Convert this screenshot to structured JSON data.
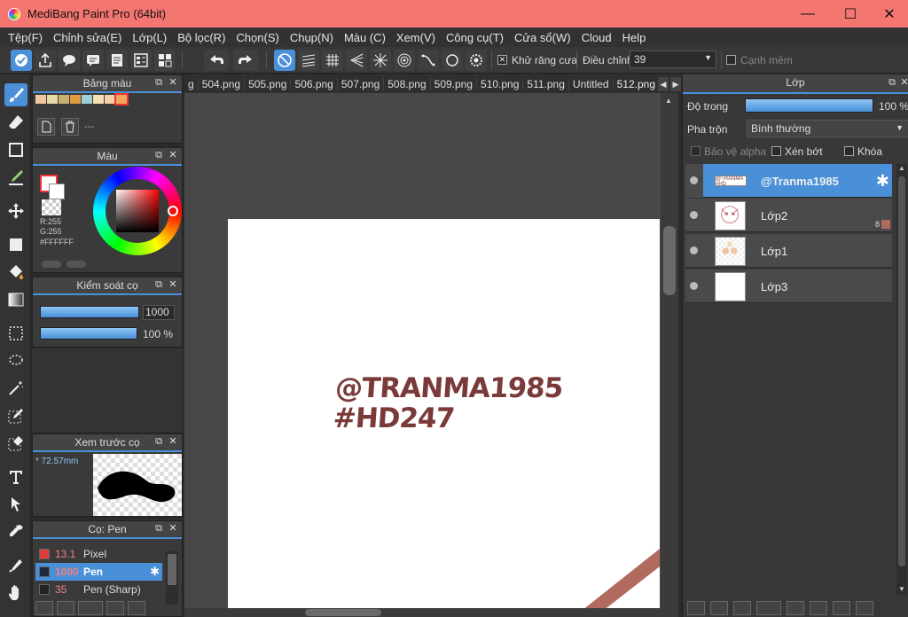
{
  "window": {
    "title": "MediBang Paint Pro (64bit)"
  },
  "menu": [
    "Tệp(F)",
    "Chỉnh sửa(E)",
    "Lớp(L)",
    "Bộ lọc(R)",
    "Chọn(S)",
    "Chụp(N)",
    "Màu (C)",
    "Xem(V)",
    "Công cụ(T)",
    "Cửa sổ(W)",
    "Cloud",
    "Help"
  ],
  "toolbar": {
    "antialias_label": "Khử răng cưa",
    "adjust_label": "Điều chỉnh",
    "adjust_value": "39",
    "smooth_edge_label": "Cạnh mềm"
  },
  "tabs": [
    "g",
    "504.png",
    "505.png",
    "506.png",
    "507.png",
    "508.png",
    "509.png",
    "510.png",
    "511.png",
    "Untitled",
    "512.png"
  ],
  "palette_panel": {
    "title": "Bảng màu",
    "set_label": "---"
  },
  "color_panel": {
    "title": "Màu",
    "r": "R:255",
    "g": "G:255",
    "hex": "#FFFFFF"
  },
  "brush_control": {
    "title": "Kiểm soát cọ",
    "size": "1000",
    "opacity": "100 %"
  },
  "brush_preview": {
    "title": "Xem trước cọ",
    "size": "72.57mm"
  },
  "brush_list": {
    "title": "Cọ: Pen",
    "items": [
      {
        "size": "13.1",
        "name": "Pixel",
        "color": "#e23b3b"
      },
      {
        "size": "1000",
        "name": "Pen",
        "color": "#1e2a3a"
      },
      {
        "size": "35",
        "name": "Pen (Sharp)",
        "color": "#222222"
      }
    ]
  },
  "canvas": {
    "text_line1": "@TRANMA1985",
    "text_line2": "#HD247",
    "text_color": "#7a3a3a"
  },
  "layer_panel": {
    "title": "Lớp",
    "opacity_label": "Độ trong",
    "opacity_value": "100 %",
    "blend_label": "Pha trộn",
    "blend_value": "Bình thường",
    "protect_alpha_label": "Bảo vệ alpha",
    "clipping_label": "Xén bớt",
    "lock_label": "Khóa",
    "layers": [
      {
        "name": "@Tranma1985"
      },
      {
        "name": "Lớp2",
        "badge": "8"
      },
      {
        "name": "Lớp1"
      },
      {
        "name": "Lớp3"
      }
    ]
  },
  "colors": {
    "accent": "#4a90d9",
    "titlebar": "#f47670"
  }
}
